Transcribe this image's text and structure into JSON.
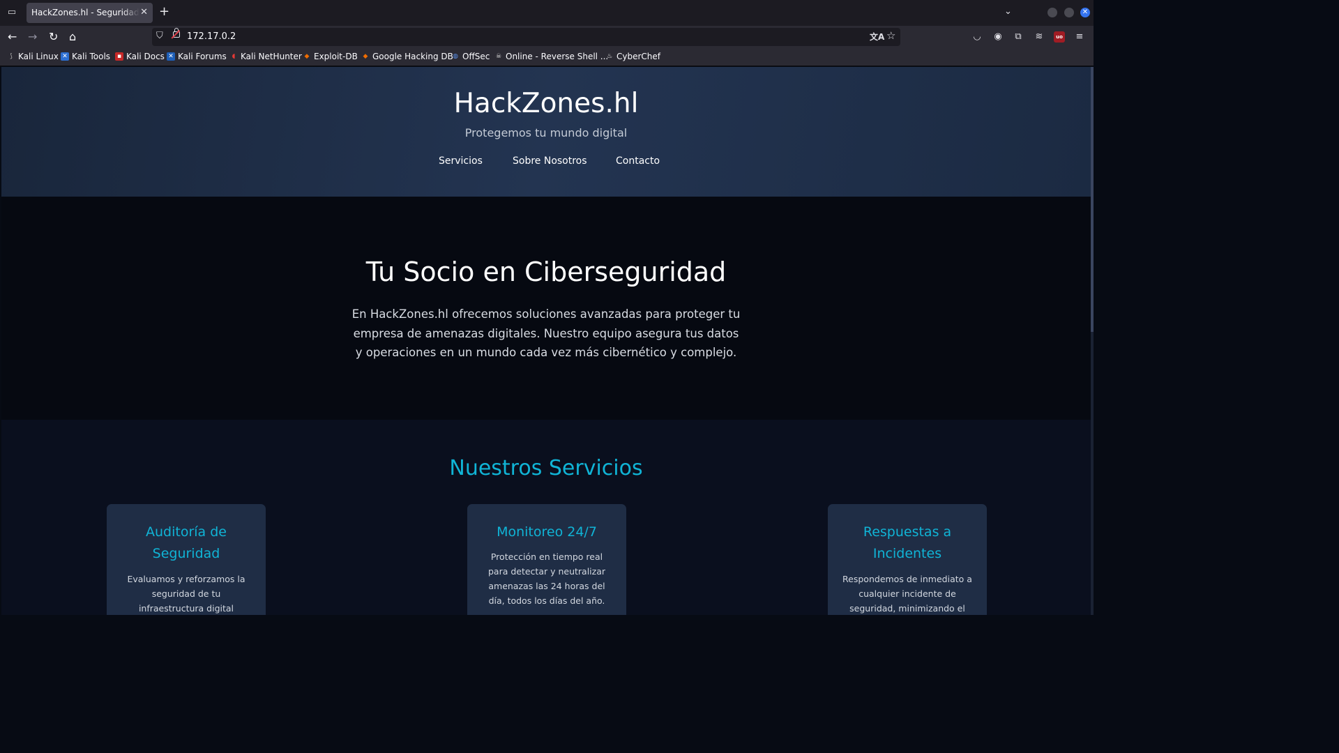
{
  "browser": {
    "tab_title": "HackZones.hl - Seguridad para",
    "url": "172.17.0.2",
    "bookmarks": [
      "Kali Linux",
      "Kali Tools",
      "Kali Docs",
      "Kali Forums",
      "Kali NetHunter",
      "Exploit-DB",
      "Google Hacking DB",
      "OffSec",
      "Online - Reverse Shell ...",
      "CyberChef"
    ],
    "colors": {
      "tabbar": "#1c1b22",
      "toolbar": "#2b2a33",
      "active_tab": "#42414d"
    }
  },
  "site": {
    "title": "HackZones.hl",
    "tagline": "Protegemos tu mundo digital",
    "nav": [
      "Servicios",
      "Sobre Nosotros",
      "Contacto"
    ]
  },
  "hero": {
    "heading": "Tu Socio en Ciberseguridad",
    "text": "En HackZones.hl ofrecemos soluciones avanzadas para proteger tu empresa de amenazas digitales. Nuestro equipo asegura tus datos y operaciones en un mundo cada vez más cibernético y complejo."
  },
  "services": {
    "heading": "Nuestros Servicios",
    "cards": [
      {
        "title": "Auditoría de Seguridad",
        "text": "Evaluamos y reforzamos la seguridad de tu infraestructura digital"
      },
      {
        "title": "Monitoreo 24/7",
        "text": "Protección en tiempo real para detectar y neutralizar amenazas las 24 horas del día, todos los días del año."
      },
      {
        "title": "Respuestas a Incidentes",
        "text": "Respondemos de inmediato a cualquier incidente de seguridad, minimizando el"
      }
    ]
  },
  "theme": {
    "accent": "#10b4d6",
    "header_bg": "#233451",
    "hero_bg": "#060911",
    "card_bg": "#1f2d45"
  }
}
